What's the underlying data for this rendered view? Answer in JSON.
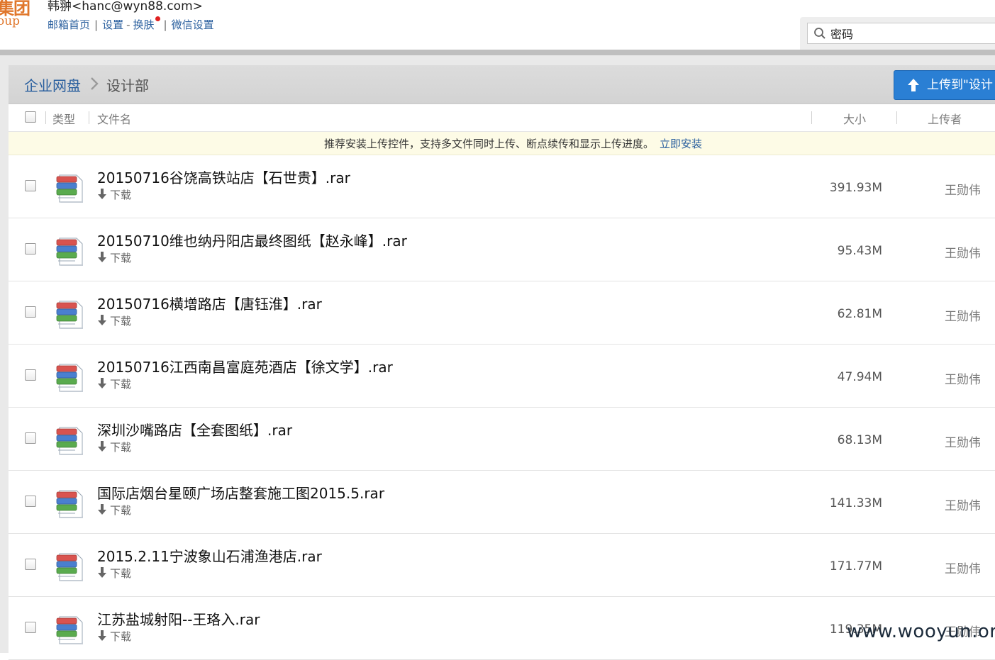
{
  "header": {
    "logo_cn": "集团",
    "logo_en": "oup",
    "user": "韩翀<hanc@wyn88.com>",
    "nav": {
      "home": "邮箱首页",
      "sep1": "|",
      "settings": "设置",
      "dash": "-",
      "skin": "换肤",
      "sep2": "|",
      "wechat": "微信设置"
    },
    "search": {
      "value": "密码"
    }
  },
  "breadcrumb": {
    "root": "企业网盘",
    "current": "设计部"
  },
  "upload_button": {
    "label": "上传到\"设计"
  },
  "columns": {
    "type": "类型",
    "name": "文件名",
    "size": "大小",
    "uploader": "上传者"
  },
  "notice": {
    "text": "推荐安装上传控件，支持多文件同时上传、断点续传和显示上传进度。",
    "link": "立即安装"
  },
  "files": [
    {
      "name": "20150716谷饶高铁站店【石世贵】.rar",
      "download": "下载",
      "size": "391.93M",
      "uploader": "王勋伟"
    },
    {
      "name": "20150710维也纳丹阳店最终图纸【赵永峰】.rar",
      "download": "下载",
      "size": "95.43M",
      "uploader": "王勋伟"
    },
    {
      "name": "20150716横增路店【唐钰淮】.rar",
      "download": "下载",
      "size": "62.81M",
      "uploader": "王勋伟"
    },
    {
      "name": "20150716江西南昌富庭苑酒店【徐文学】.rar",
      "download": "下载",
      "size": "47.94M",
      "uploader": "王勋伟"
    },
    {
      "name": "深圳沙嘴路店【全套图纸】.rar",
      "download": "下载",
      "size": "68.13M",
      "uploader": "王勋伟"
    },
    {
      "name": "国际店烟台星颐广场店整套施工图2015.5.rar",
      "download": "下载",
      "size": "141.33M",
      "uploader": "王勋伟"
    },
    {
      "name": "2015.2.11宁波象山石浦渔港店.rar",
      "download": "下载",
      "size": "171.77M",
      "uploader": "王勋伟"
    },
    {
      "name": "江苏盐城射阳--王珞入.rar",
      "download": "下载",
      "size": "119.35M",
      "uploader": "王勋伟"
    }
  ],
  "watermark": "www.wooyun.org",
  "colors": {
    "link": "#2a5f9e",
    "upload_button": "#2a7fd4",
    "notice_bg": "#fdfbe6",
    "logo": "#e0762a"
  },
  "icons": {
    "search": "magnifier-icon",
    "chevron": "chevron-right-icon",
    "upload": "arrow-up-icon",
    "file": "rar-archive-icon",
    "download": "arrow-down-icon"
  }
}
